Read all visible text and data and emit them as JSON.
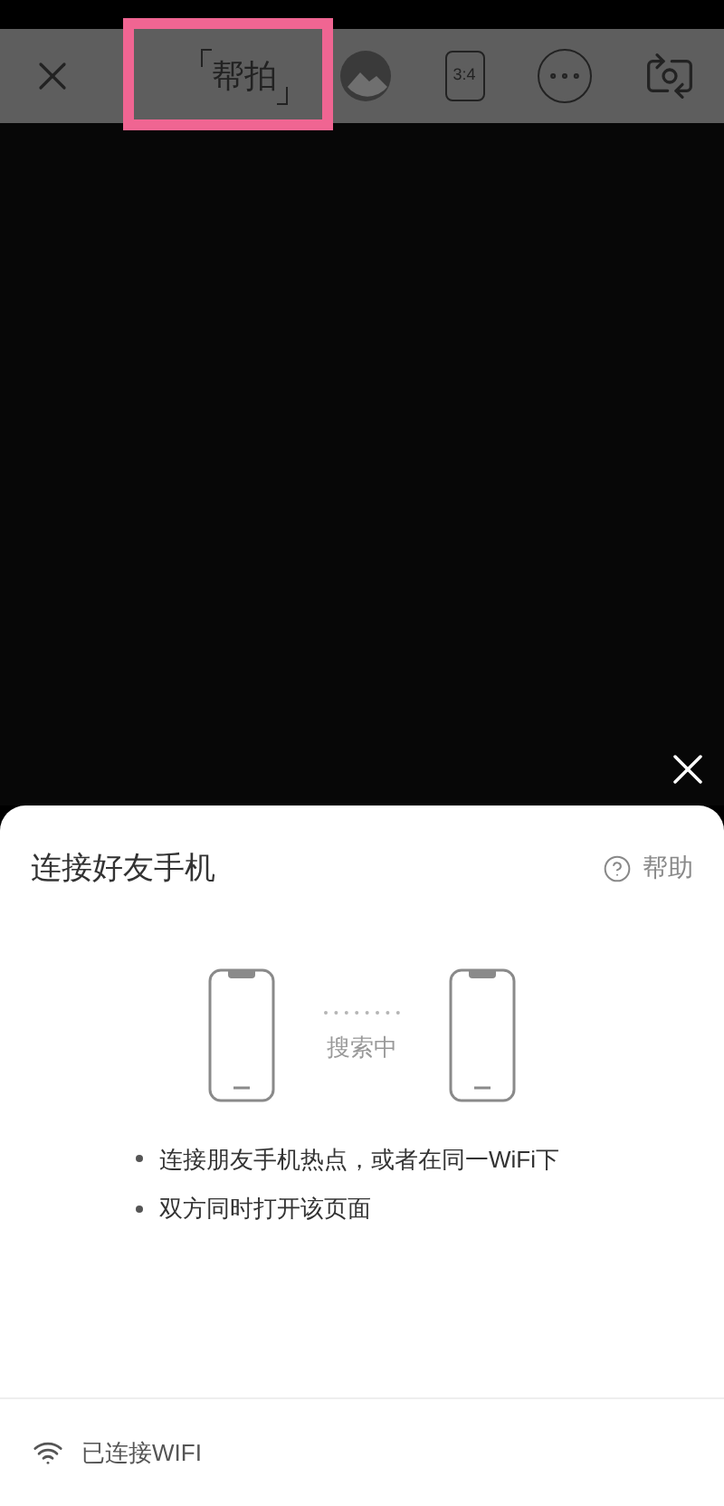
{
  "top_bar": {
    "mode_label": "帮拍",
    "ratio_label": "3:4"
  },
  "sheet": {
    "title": "连接好友手机",
    "help": "帮助",
    "status": "搜索中",
    "tips": [
      "连接朋友手机热点，或者在同一WiFi下",
      "双方同时打开该页面"
    ],
    "footer": "已连接WIFI"
  }
}
